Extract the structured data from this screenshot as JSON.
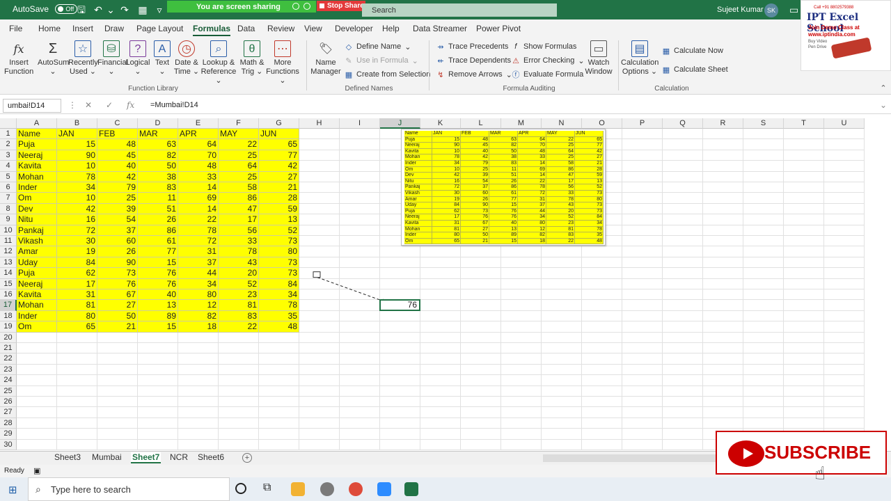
{
  "titlebar": {
    "autosave_label": "AutoSave",
    "autosave_state": "Off",
    "sharing_text": "You are screen sharing",
    "stop_share_label": "Stop Share",
    "search_placeholder": "Search",
    "user_name": "Sujeet Kumar",
    "user_initials": "SK"
  },
  "menu_tabs": [
    "File",
    "Home",
    "Insert",
    "Draw",
    "Page Layout",
    "Formulas",
    "Data",
    "Review",
    "View",
    "Developer",
    "Help",
    "Data Streamer",
    "Power Pivot"
  ],
  "active_menu": "Formulas",
  "ribbon": {
    "function_library": {
      "label": "Function Library",
      "buttons": [
        {
          "line1": "Insert",
          "line2": "Function"
        },
        {
          "line1": "AutoSum",
          "line2": "⌄"
        },
        {
          "line1": "Recently",
          "line2": "Used ⌄"
        },
        {
          "line1": "Financial",
          "line2": "⌄"
        },
        {
          "line1": "Logical",
          "line2": "⌄"
        },
        {
          "line1": "Text",
          "line2": "⌄"
        },
        {
          "line1": "Date &",
          "line2": "Time ⌄"
        },
        {
          "line1": "Lookup &",
          "line2": "Reference ⌄"
        },
        {
          "line1": "Math &",
          "line2": "Trig ⌄"
        },
        {
          "line1": "More",
          "line2": "Functions ⌄"
        }
      ]
    },
    "defined_names": {
      "label": "Defined Names",
      "name_manager": {
        "line1": "Name",
        "line2": "Manager"
      },
      "define_name": "Define Name",
      "use_in_formula": "Use in Formula",
      "create_from_selection": "Create from Selection"
    },
    "formula_auditing": {
      "label": "Formula Auditing",
      "trace_precedents": "Trace Precedents",
      "trace_dependents": "Trace Dependents",
      "remove_arrows": "Remove Arrows",
      "show_formulas": "Show Formulas",
      "error_checking": "Error Checking",
      "evaluate_formula": "Evaluate Formula",
      "watch_window": {
        "line1": "Watch",
        "line2": "Window"
      }
    },
    "calculation": {
      "label": "Calculation",
      "options": {
        "line1": "Calculation",
        "line2": "Options ⌄"
      },
      "calculate_now": "Calculate Now",
      "calculate_sheet": "Calculate Sheet"
    }
  },
  "formula_bar": {
    "name_box": "umbai!D14",
    "formula": "=Mumbai!D14"
  },
  "columns": [
    "A",
    "B",
    "C",
    "D",
    "E",
    "F",
    "G",
    "H",
    "I",
    "J",
    "K",
    "L",
    "M",
    "N",
    "O",
    "P",
    "Q",
    "R",
    "S",
    "T",
    "U"
  ],
  "rows": [
    "1",
    "2",
    "3",
    "4",
    "5",
    "6",
    "7",
    "8",
    "9",
    "10",
    "11",
    "12",
    "13",
    "14",
    "15",
    "16",
    "17",
    "18",
    "19",
    "20",
    "21",
    "22",
    "23",
    "24",
    "25",
    "26",
    "27",
    "28",
    "29",
    "30"
  ],
  "table": {
    "header": [
      "Name",
      "JAN",
      "FEB",
      "MAR",
      "APR",
      "MAY",
      "JUN"
    ],
    "rows": [
      [
        "Puja",
        "15",
        "48",
        "63",
        "64",
        "22",
        "65"
      ],
      [
        "Neeraj",
        "90",
        "45",
        "82",
        "70",
        "25",
        "77"
      ],
      [
        "Kavita",
        "10",
        "40",
        "50",
        "48",
        "64",
        "42"
      ],
      [
        "Mohan",
        "78",
        "42",
        "38",
        "33",
        "25",
        "27"
      ],
      [
        "Inder",
        "34",
        "79",
        "83",
        "14",
        "58",
        "21"
      ],
      [
        "Om",
        "10",
        "25",
        "11",
        "69",
        "86",
        "28"
      ],
      [
        "Dev",
        "42",
        "39",
        "51",
        "14",
        "47",
        "59"
      ],
      [
        "Nitu",
        "16",
        "54",
        "26",
        "22",
        "17",
        "13"
      ],
      [
        "Pankaj",
        "72",
        "37",
        "86",
        "78",
        "56",
        "52"
      ],
      [
        "Vikash",
        "30",
        "60",
        "61",
        "72",
        "33",
        "73"
      ],
      [
        "Amar",
        "19",
        "26",
        "77",
        "31",
        "78",
        "80"
      ],
      [
        "Uday",
        "84",
        "90",
        "15",
        "37",
        "43",
        "73"
      ],
      [
        "Puja",
        "62",
        "73",
        "76",
        "44",
        "20",
        "73"
      ],
      [
        "Neeraj",
        "17",
        "76",
        "76",
        "34",
        "52",
        "84"
      ],
      [
        "Kavita",
        "31",
        "67",
        "40",
        "80",
        "23",
        "34"
      ],
      [
        "Mohan",
        "81",
        "27",
        "13",
        "12",
        "81",
        "78"
      ],
      [
        "Inder",
        "80",
        "50",
        "89",
        "82",
        "83",
        "35"
      ],
      [
        "Om",
        "65",
        "21",
        "15",
        "18",
        "22",
        "48"
      ]
    ]
  },
  "active_cell": {
    "ref": "J17",
    "value": "76"
  },
  "sheets": [
    "Sheet3",
    "Mumbai",
    "Sheet7",
    "NCR",
    "Sheet6"
  ],
  "active_sheet": "Sheet7",
  "status": "Ready",
  "taskbar": {
    "search_placeholder": "Type here to search"
  },
  "logo": {
    "phone": "Call +91 8802579388",
    "brand": "IPT Excel School",
    "line1": "Join Demo Class at",
    "url": "www.iptindia.com",
    "line2": "Buy Video",
    "line3": "Pen Drive"
  },
  "subscribe_label": "SUBSCRIBE",
  "colors": {
    "excel_green": "#217346",
    "highlight": "#ffff00",
    "subscribe_red": "#cc0000"
  }
}
